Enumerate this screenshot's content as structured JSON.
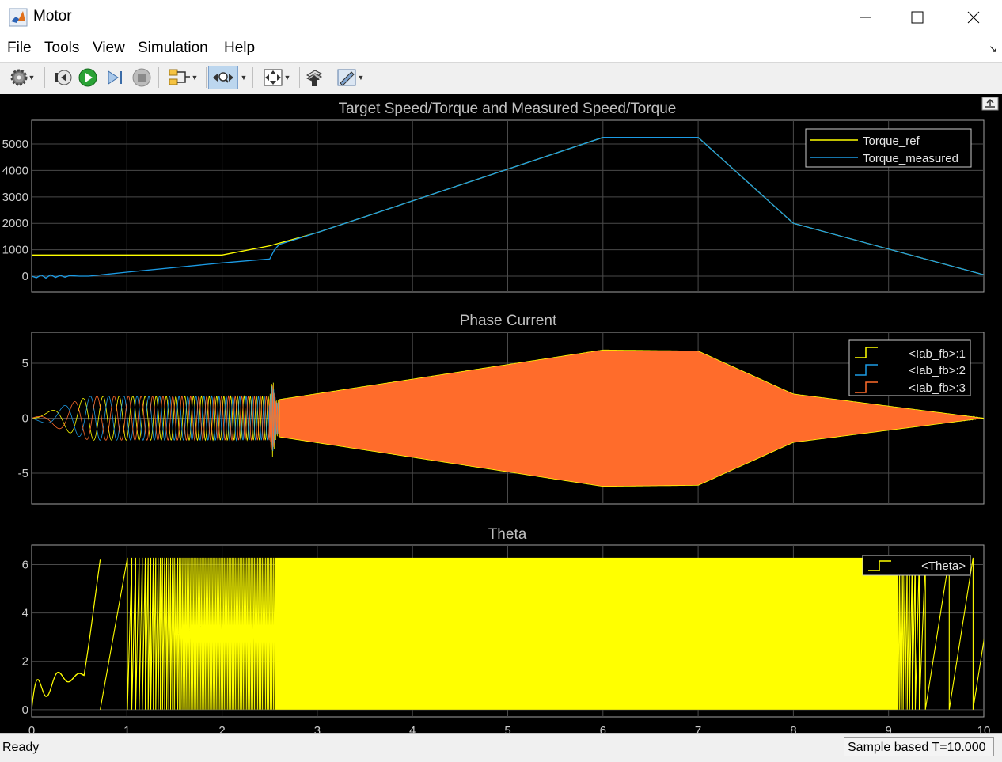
{
  "window": {
    "title": "Motor"
  },
  "menu": {
    "items": [
      "File",
      "Tools",
      "View",
      "Simulation",
      "Help"
    ]
  },
  "toolbar": {
    "icons": [
      "gear-icon",
      "step-back-icon",
      "run-icon",
      "step-forward-icon",
      "stop-icon",
      "signal-selector-icon",
      "zoom-icon",
      "fit-to-view-icon",
      "write-to-workspace-icon",
      "style-icon"
    ]
  },
  "status": {
    "left": "Ready",
    "right": "Sample based   T=10.000"
  },
  "colors": {
    "background": "#000000",
    "grid": "#505050",
    "axis_text": "#cccccc",
    "title_text": "#bfbfbf",
    "yellow": "#ffff00",
    "blue": "#1c9ce6",
    "orange": "#ff6c2b"
  },
  "chart_data": [
    {
      "type": "line",
      "title": "Target Speed/Torque and Measured Speed/Torque",
      "xlim": [
        0,
        10
      ],
      "ylim": [
        -600,
        5900
      ],
      "yticks": [
        0,
        1000,
        2000,
        3000,
        4000,
        5000
      ],
      "grid": true,
      "legend_position": "top-right",
      "series": [
        {
          "name": "Torque_ref",
          "color": "#ffff00",
          "x": [
            0,
            2,
            2.5,
            3,
            6,
            7,
            8,
            10
          ],
          "y": [
            800,
            800,
            1150,
            1650,
            5250,
            5250,
            2000,
            50
          ]
        },
        {
          "name": "Torque_measured",
          "color": "#1c9ce6",
          "x": [
            0,
            0.05,
            0.1,
            0.15,
            0.2,
            0.25,
            0.3,
            0.35,
            0.4,
            0.5,
            0.6,
            1,
            2,
            2.5,
            2.55,
            2.6,
            3,
            6,
            7,
            8,
            10
          ],
          "y": [
            0,
            -60,
            40,
            -70,
            50,
            -50,
            30,
            -40,
            20,
            0,
            0,
            150,
            500,
            650,
            1000,
            1200,
            1650,
            5250,
            5250,
            2000,
            50
          ]
        }
      ]
    },
    {
      "type": "line",
      "title": "Phase Current",
      "xlim": [
        0,
        10
      ],
      "ylim": [
        -7.8,
        7.8
      ],
      "yticks": [
        -5,
        0,
        5
      ],
      "grid": true,
      "legend_position": "top-right",
      "series": [
        {
          "name": "<Iab_fb>:1",
          "color": "#ffff00"
        },
        {
          "name": "<Iab_fb>:2",
          "color": "#1c9ce6"
        },
        {
          "name": "<Iab_fb>:3",
          "color": "#ff6c2b"
        }
      ],
      "envelope": {
        "x": [
          0,
          0.6,
          2.5,
          2.53,
          2.57,
          2.6,
          6,
          7,
          8,
          10
        ],
        "amplitude": [
          0,
          2,
          2,
          3.6,
          1.6,
          1.7,
          6.2,
          6.1,
          2.2,
          0
        ]
      }
    },
    {
      "type": "line",
      "title": "Theta",
      "xlim": [
        0,
        10
      ],
      "ylim": [
        -0.3,
        6.8
      ],
      "yticks": [
        0,
        2,
        4,
        6
      ],
      "xticks": [
        0,
        1,
        2,
        3,
        4,
        5,
        6,
        7,
        8,
        9,
        10
      ],
      "grid": true,
      "legend_position": "top-right",
      "series": [
        {
          "name": "<Theta>",
          "color": "#ffff00"
        }
      ],
      "range": [
        0,
        6.28
      ]
    }
  ]
}
